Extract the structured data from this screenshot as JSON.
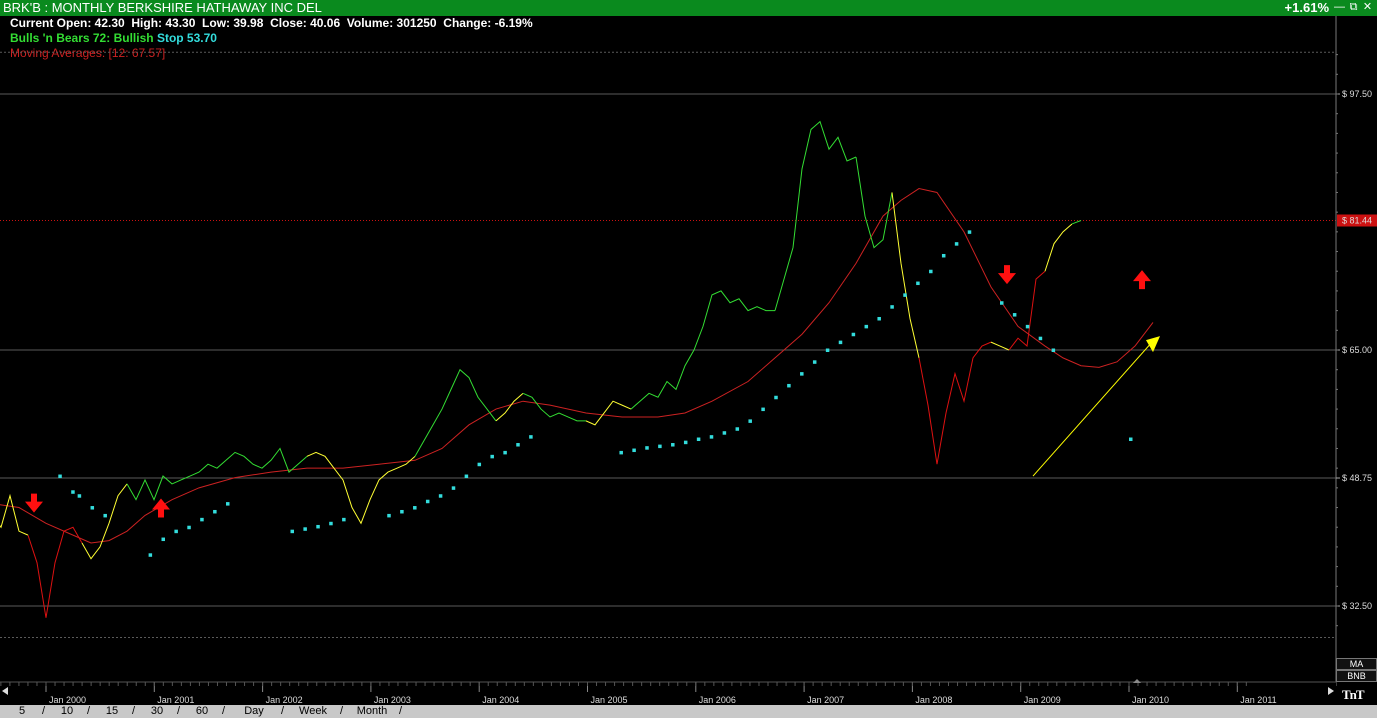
{
  "window": {
    "title": "BRK'B : MONTHLY BERKSHIRE HATHAWAY INC DEL",
    "change_pct": "+1.61%",
    "minimize_icon": "minimize-icon",
    "restore_icon": "restore-icon",
    "close_icon": "close-icon"
  },
  "info": {
    "line1": "Current Open: 42.30  High: 43.30  Low: 39.98  Close: 40.06  Volume: 301250  Change: -6.19%",
    "bnb_label": "Bulls 'n Bears 72:",
    "bnb_value": "Bullish",
    "stop_label": "Stop 53.70",
    "ma_label": "Moving Averages:",
    "ma_value": "[12: 67.57]"
  },
  "colors": {
    "bullish": "#33dd33",
    "neutral": "#ffff33",
    "bearish": "#dd1111",
    "stop_dots": "#33dddd",
    "moving_average": "#cc2222",
    "current_price": "#cc1111"
  },
  "price_axis": {
    "ticks": [
      "$ 97.50",
      "$ 65.00",
      "$ 48.75",
      "$ 32.50"
    ],
    "tick_values": [
      97.5,
      65.0,
      48.75,
      32.5
    ],
    "current_price_label": "$ 81.44",
    "current_price": 81.44
  },
  "time_axis": {
    "labels": [
      "Jan 2000",
      "Jan 2001",
      "Jan 2002",
      "Jan 2003",
      "Jan 2004",
      "Jan 2005",
      "Jan 2006",
      "Jan 2007",
      "Jan 2008",
      "Jan 2009",
      "Jan 2010",
      "Jan 2011"
    ]
  },
  "side_buttons": {
    "ma": "MA",
    "bnb": "BNB",
    "logo": "TnT"
  },
  "timeframes": [
    "5",
    "10",
    "15",
    "30",
    "60",
    "Day",
    "Week",
    "Month"
  ],
  "chart_data": {
    "type": "line",
    "title": "BRK'B : MONTHLY BERKSHIRE HATHAWAY INC DEL",
    "xlabel": "",
    "ylabel": "",
    "ylim": [
      22,
      107
    ],
    "x_start": "1999-07",
    "price_series": {
      "name": "Close",
      "segments": [
        {
          "signal": "neutral",
          "values": [
            [
              0,
              44.0
            ],
            [
              1,
              42.5
            ],
            [
              2,
              46.5
            ],
            [
              3,
              42.0
            ],
            [
              4,
              41.5
            ]
          ]
        },
        {
          "signal": "bearish",
          "values": [
            [
              4,
              41.5
            ],
            [
              5,
              38.0
            ],
            [
              6,
              31.0
            ],
            [
              7,
              38.0
            ],
            [
              8,
              42.0
            ],
            [
              9,
              42.5
            ],
            [
              10,
              40.5
            ]
          ]
        },
        {
          "signal": "neutral",
          "values": [
            [
              10,
              40.5
            ],
            [
              11,
              38.5
            ],
            [
              12,
              40.0
            ],
            [
              13,
              43.0
            ],
            [
              14,
              46.5
            ],
            [
              15,
              48.0
            ]
          ]
        },
        {
          "signal": "bullish",
          "values": [
            [
              15,
              48.0
            ],
            [
              16,
              46.0
            ],
            [
              17,
              48.5
            ],
            [
              18,
              46.0
            ],
            [
              19,
              49.0
            ],
            [
              20,
              48.0
            ],
            [
              21,
              48.5
            ],
            [
              22,
              49.0
            ],
            [
              23,
              49.5
            ],
            [
              24,
              50.5
            ],
            [
              25,
              50.0
            ],
            [
              26,
              51.0
            ]
          ]
        },
        {
          "signal": "bullish",
          "values": [
            [
              26,
              51.0
            ],
            [
              27,
              52.0
            ],
            [
              28,
              51.5
            ],
            [
              29,
              50.5
            ],
            [
              30,
              50.0
            ],
            [
              31,
              51.0
            ],
            [
              32,
              52.5
            ],
            [
              33,
              49.5
            ],
            [
              34,
              50.5
            ],
            [
              35,
              51.5
            ]
          ]
        },
        {
          "signal": "neutral",
          "values": [
            [
              35,
              51.5
            ],
            [
              36,
              52.0
            ],
            [
              37,
              51.5
            ],
            [
              38,
              50.0
            ],
            [
              39,
              48.5
            ],
            [
              40,
              45.0
            ],
            [
              41,
              43.0
            ],
            [
              42,
              46.0
            ],
            [
              43,
              48.5
            ],
            [
              44,
              49.5
            ],
            [
              45,
              50.0
            ],
            [
              46,
              50.5
            ],
            [
              47,
              51.5
            ]
          ]
        },
        {
          "signal": "bullish",
          "values": [
            [
              47,
              51.5
            ],
            [
              48,
              53.5
            ],
            [
              49,
              55.5
            ],
            [
              50,
              57.5
            ],
            [
              51,
              60.0
            ],
            [
              52,
              62.5
            ],
            [
              53,
              61.5
            ],
            [
              54,
              59.0
            ],
            [
              55,
              57.5
            ],
            [
              56,
              56.0
            ]
          ]
        },
        {
          "signal": "neutral",
          "values": [
            [
              56,
              56.0
            ],
            [
              57,
              57.0
            ],
            [
              58,
              58.5
            ],
            [
              59,
              59.5
            ]
          ]
        },
        {
          "signal": "bullish",
          "values": [
            [
              59,
              59.5
            ],
            [
              60,
              59.0
            ],
            [
              61,
              57.5
            ],
            [
              62,
              56.5
            ],
            [
              63,
              57.0
            ],
            [
              64,
              56.5
            ],
            [
              65,
              56.0
            ],
            [
              66,
              56.0
            ]
          ]
        },
        {
          "signal": "neutral",
          "values": [
            [
              66,
              56.0
            ],
            [
              67,
              55.5
            ],
            [
              68,
              57.0
            ],
            [
              69,
              58.5
            ],
            [
              70,
              58.0
            ],
            [
              71,
              57.5
            ]
          ]
        },
        {
          "signal": "bullish",
          "values": [
            [
              71,
              57.5
            ],
            [
              72,
              58.5
            ],
            [
              73,
              59.5
            ],
            [
              74,
              59.0
            ],
            [
              75,
              61.0
            ],
            [
              76,
              60.0
            ],
            [
              77,
              63.0
            ],
            [
              78,
              65.0
            ],
            [
              79,
              68.0
            ],
            [
              80,
              72.0
            ],
            [
              81,
              72.5
            ],
            [
              82,
              71.0
            ],
            [
              83,
              71.5
            ],
            [
              84,
              70.0
            ],
            [
              85,
              70.5
            ],
            [
              86,
              70.0
            ],
            [
              87,
              70.0
            ]
          ]
        },
        {
          "signal": "bullish",
          "values": [
            [
              87,
              70.0
            ],
            [
              88,
              74.0
            ],
            [
              89,
              78.0
            ],
            [
              90,
              88.0
            ],
            [
              91,
              93.0
            ],
            [
              92,
              94.0
            ],
            [
              93,
              90.5
            ],
            [
              94,
              92.0
            ],
            [
              95,
              89.0
            ],
            [
              96,
              89.5
            ]
          ]
        },
        {
          "signal": "bullish",
          "values": [
            [
              96,
              89.5
            ],
            [
              97,
              82.0
            ],
            [
              98,
              78.0
            ],
            [
              99,
              79.0
            ],
            [
              100,
              85.0
            ]
          ]
        },
        {
          "signal": "neutral",
          "values": [
            [
              100,
              85.0
            ],
            [
              101,
              76.0
            ],
            [
              102,
              69.0
            ],
            [
              103,
              64.0
            ]
          ]
        },
        {
          "signal": "bearish",
          "values": [
            [
              103,
              64.0
            ],
            [
              104,
              58.0
            ],
            [
              105,
              50.5
            ],
            [
              106,
              57.0
            ],
            [
              107,
              62.0
            ],
            [
              108,
              58.5
            ],
            [
              109,
              64.0
            ],
            [
              110,
              65.5
            ],
            [
              111,
              66.0
            ]
          ]
        },
        {
          "signal": "neutral",
          "values": [
            [
              111,
              66.0
            ],
            [
              112,
              65.5
            ],
            [
              113,
              65.0
            ]
          ]
        },
        {
          "signal": "bearish",
          "values": [
            [
              113,
              65.0
            ],
            [
              114,
              66.5
            ],
            [
              115,
              65.5
            ],
            [
              116,
              74.0
            ],
            [
              117,
              75.0
            ]
          ]
        },
        {
          "signal": "neutral",
          "values": [
            [
              117,
              75.0
            ],
            [
              118,
              78.5
            ],
            [
              119,
              80.0
            ],
            [
              120,
              81.0
            ]
          ]
        },
        {
          "signal": "bullish",
          "values": [
            [
              120,
              81.0
            ],
            [
              121,
              81.44
            ]
          ]
        }
      ]
    },
    "moving_average": {
      "name": "Moving Averages [12]",
      "values": [
        [
          0,
          45.5
        ],
        [
          3,
          45.0
        ],
        [
          6,
          43.0
        ],
        [
          9,
          41.5
        ],
        [
          11,
          40.5
        ],
        [
          13,
          40.8
        ],
        [
          15,
          42.0
        ],
        [
          17,
          44.0
        ],
        [
          20,
          46.0
        ],
        [
          23,
          47.5
        ],
        [
          27,
          48.8
        ],
        [
          31,
          49.5
        ],
        [
          35,
          50.0
        ],
        [
          39,
          50.0
        ],
        [
          43,
          50.5
        ],
        [
          47,
          51.0
        ],
        [
          50,
          52.5
        ],
        [
          53,
          55.5
        ],
        [
          56,
          57.5
        ],
        [
          59,
          58.5
        ],
        [
          62,
          58.0
        ],
        [
          66,
          57.0
        ],
        [
          70,
          56.5
        ],
        [
          74,
          56.5
        ],
        [
          77,
          57.0
        ],
        [
          80,
          58.5
        ],
        [
          84,
          61.0
        ],
        [
          87,
          64.0
        ],
        [
          90,
          67.0
        ],
        [
          93,
          71.0
        ],
        [
          96,
          76.0
        ],
        [
          99,
          82.0
        ],
        [
          101,
          84.0
        ],
        [
          103,
          85.5
        ],
        [
          105,
          85.0
        ],
        [
          108,
          80.0
        ],
        [
          111,
          73.0
        ],
        [
          114,
          68.0
        ],
        [
          117,
          65.5
        ],
        [
          119,
          64.0
        ],
        [
          121,
          63.0
        ],
        [
          123,
          62.8
        ],
        [
          125,
          63.5
        ],
        [
          127,
          65.5
        ],
        [
          129,
          68.5
        ]
      ]
    },
    "stop_dots": [
      [
        4,
        49.0
      ],
      [
        6,
        47.0
      ],
      [
        7,
        46.5
      ],
      [
        9,
        45.0
      ],
      [
        11,
        44.0
      ],
      [
        18,
        39.0
      ],
      [
        20,
        41.0
      ],
      [
        22,
        42.0
      ],
      [
        24,
        42.5
      ],
      [
        26,
        43.5
      ],
      [
        28,
        44.5
      ],
      [
        30,
        45.5
      ],
      [
        40,
        42.0
      ],
      [
        42,
        42.3
      ],
      [
        44,
        42.6
      ],
      [
        46,
        43.0
      ],
      [
        48,
        43.5
      ],
      [
        55,
        44.0
      ],
      [
        57,
        44.5
      ],
      [
        59,
        45.0
      ],
      [
        61,
        45.8
      ],
      [
        63,
        46.5
      ],
      [
        65,
        47.5
      ],
      [
        67,
        49.0
      ],
      [
        69,
        50.5
      ],
      [
        71,
        51.5
      ],
      [
        73,
        52.0
      ],
      [
        75,
        53.0
      ],
      [
        77,
        54.0
      ],
      [
        91,
        52.0
      ],
      [
        93,
        52.3
      ],
      [
        95,
        52.6
      ],
      [
        97,
        52.8
      ],
      [
        99,
        53.0
      ],
      [
        101,
        53.3
      ],
      [
        103,
        53.7
      ],
      [
        105,
        54.0
      ],
      [
        107,
        54.5
      ],
      [
        109,
        55.0
      ],
      [
        111,
        56.0
      ],
      [
        113,
        57.5
      ],
      [
        115,
        59.0
      ],
      [
        117,
        60.5
      ],
      [
        119,
        62.0
      ],
      [
        121,
        63.5
      ],
      [
        123,
        65.0
      ],
      [
        125,
        66.0
      ],
      [
        127,
        67.0
      ],
      [
        129,
        68.0
      ],
      [
        131,
        69.0
      ],
      [
        133,
        70.5
      ],
      [
        135,
        72.0
      ],
      [
        137,
        73.5
      ],
      [
        139,
        75.0
      ],
      [
        141,
        77.0
      ],
      [
        143,
        78.5
      ],
      [
        145,
        80.0
      ],
      [
        150,
        71.0
      ],
      [
        152,
        69.5
      ],
      [
        154,
        68.0
      ],
      [
        156,
        66.5
      ],
      [
        158,
        65.0
      ],
      [
        170,
        53.7
      ]
    ],
    "signal_arrows": [
      {
        "type": "down",
        "x": 4,
        "y": 45.5
      },
      {
        "type": "up",
        "x": 19,
        "y": 45.0
      },
      {
        "type": "down",
        "x": 123,
        "y": 74.5
      },
      {
        "type": "up",
        "x": 138,
        "y": 74.0
      }
    ],
    "trendline": {
      "from": [
        125,
        49.0
      ],
      "to": [
        142,
        66.0
      ],
      "color": "#ffff00"
    }
  }
}
